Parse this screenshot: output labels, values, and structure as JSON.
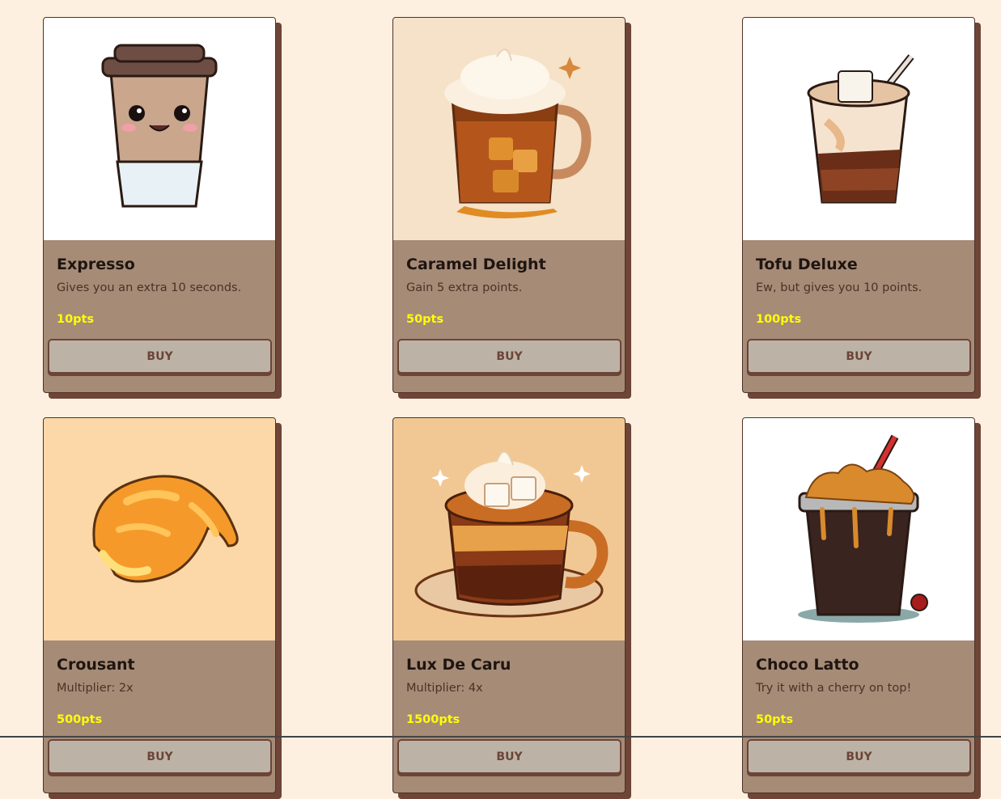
{
  "shop": {
    "items": [
      {
        "name": "Expresso",
        "description": "Gives you an extra 10 seconds.",
        "price": "10pts",
        "button": "BUY",
        "image_icon": "coffee-cup-icon"
      },
      {
        "name": "Caramel Delight",
        "description": "Gain 5 extra points.",
        "price": "50pts",
        "button": "BUY",
        "image_icon": "caramel-mug-icon"
      },
      {
        "name": "Tofu Deluxe",
        "description": "Ew, but gives you 10 points.",
        "price": "100pts",
        "button": "BUY",
        "image_icon": "iced-latte-icon"
      },
      {
        "name": "Crousant",
        "description": "Multiplier: 2x",
        "price": "500pts",
        "button": "BUY",
        "image_icon": "croissant-icon"
      },
      {
        "name": "Lux De Caru",
        "description": "Multiplier: 4x",
        "price": "1500pts",
        "button": "BUY",
        "image_icon": "cocoa-mug-icon"
      },
      {
        "name": "Choco Latto",
        "description": "Try it with a cherry on top!",
        "price": "50pts",
        "button": "BUY",
        "image_icon": "choco-frappe-icon"
      }
    ]
  },
  "colors": {
    "page_bg": "#fdf0e0",
    "card_body": "#a68b77",
    "card_shadow": "#6e4537",
    "price": "#ffff00",
    "button_bg": "#bdb2a6",
    "button_text": "#6a4538"
  }
}
